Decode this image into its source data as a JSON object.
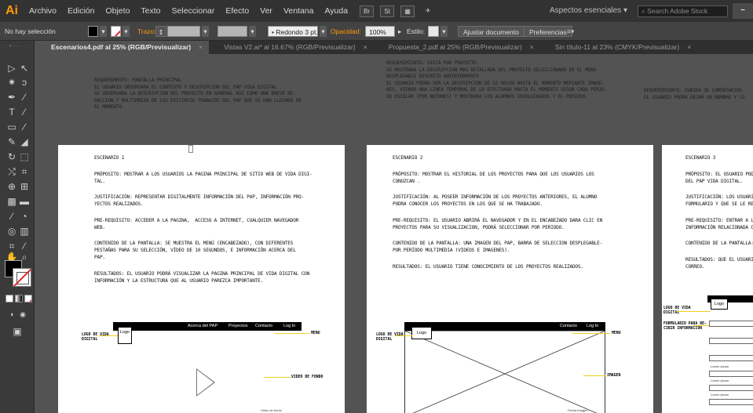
{
  "app": {
    "logo": "Ai",
    "menus": [
      "Archivo",
      "Edición",
      "Objeto",
      "Texto",
      "Seleccionar",
      "Efecto",
      "Ver",
      "Ventana",
      "Ayuda"
    ],
    "bridge_label": "Br",
    "stock_label": "St",
    "workspace": "Aspectos esenciales",
    "stock_search_placeholder": "Search Adobe Stock",
    "minimize": "–"
  },
  "control_bar": {
    "selection": "No hay selección",
    "stroke_label": "Trazo:",
    "brush": "• Redondo 3 pt.",
    "opacity_label": "Opacidad:",
    "opacity_value": "100%",
    "style_label": "Estilo:",
    "fit_button": "Ajustar documento",
    "prefs_button": "Preferencias",
    "colors": {
      "fill": "#000000",
      "stroke": "#ffffff",
      "accent": "#ff9a00"
    }
  },
  "tabs": [
    {
      "label": "Escenarios4.pdf al 25% (RGB/Previsualizar)",
      "active": true
    },
    {
      "label": "Vistas V2.ai* al 16.67% (RGB/Previsualizar)",
      "active": false
    },
    {
      "label": "Propuesta_2.pdf al 25% (RGB/Previsualizar)",
      "active": false
    },
    {
      "label": "Sin título-11 al 23% (CMYK/Previsualizar)",
      "active": false
    }
  ],
  "tab_close": "×",
  "requirements": [
    "REQUERIMENTO: PANTALLA PRINCIPAL\nEL USUARIO OBSERVARA EL CONTEXTO Y DESCRIPCION DEL PAP VIDA DIGITAL .\nSE OBSERVARA LA DESCRIPCION DEL PROYECTO EN GENERAL ASI COMO UNA BREVE RE-\nDACCION Y MULTIMEDIA DE LOS DISTINTOS TRABAJOS DEL PAP QUE SE HAN LLEVADO EN\nEL MOMENTO.",
    "REQUERIMIENTO: VISTA POR PROYECTO\nSE MOSTRARA LA DESCRIPCION MAS DETALLADA DEL PROYECTO SELECCIONADO EN EL MENU\nDESPLEGABLE DESCRITO ANTERIORMENTE.\nEL USUARIO PODRA VER LA DESCRIPCION DE LO HECHO HASTA EL MOMENTO MEDIANTE IMAGE-\nNES, VIENDO UNA LINEA TEMPORAL DE LO EFECTUADO HASTA EL MOMENTO SEGUN CADA PERIO-\nDO ESCOLAR (POR BOTONES) Y MOSTRARA LOS ALUMNOS INVOLUCRADOS Y EL PERIODO.",
    "REQUERIMIENTO: SUBIDA DE COMENTARIOS\nEL USUARIO PODRA DEJAR UN NOMBRE Y CO"
  ],
  "artboards": [
    {
      "title": "ESCENARIO 1",
      "paragraphs": [
        "PRÓPOSITO: MOSTRAR A LOS USUARIOS LA PAGINA PRINCIPAL DE SITIO WEB DE VIDA DIGI-\nTAL.",
        "JUSTIFICACIÓN: REPRESENTAR DIGITALMENTE INFORMACIÓN DEL PAP, INFORMACIÓN PRO-\nYECTOS REALIZADOS.",
        "PRE-REQUISITO: ACCEDER A LA PAGINA,  ACCESO A INTERNET, CUALQUIER NAVEGADOR\nWEB.",
        "CONTENIDO DE LA PANTALLA: SE MUESTRA EL MENÚ (ENCABEZADO), CON DIFERENTES\nPESTAÑAS PARA SU SELECCIÓN, VÍDEO DE 10 SEGUNDOS, E INFORMACIÓN ACERCA DEL\nPAP.",
        "RESULTADOS: EL USUARIO PODRÁ VISUALIZAR LA PAGINA PRINCIPAL DE VIDA DIGITAL CON\nINFORMACIÓN Y LA ESTRUCTURA QUE AL USUARIO PAREZCA IMPORTANTE."
      ],
      "nav": [
        "Acerca del PAP",
        "Proyectos",
        "Contacto",
        "Log In"
      ],
      "logo": "Logo",
      "annotations": [
        "LOGO DE VIDA\nDIGITAL",
        "MENU",
        "VIDEO DE FONDO"
      ],
      "caption": "Video de fondo"
    },
    {
      "title": "ESCENARIO 2",
      "paragraphs": [
        "PRÓPOSITO: MOSTRAR EL HISTORIAL DE LOS PROYECTOS PARA QUE LOS USUARIOS LOS\nCONOZCAN .",
        "JUSTIFICACIÓN: AL POSEER INFORMACIÓN DE LOS PROYECTOS ANTERIORES, EL ALUMNO\nPODRA CONOCER LOS PROYECTOS EN LOS QUE SE HA TRABAJADO.",
        "PRE-REQUISITO: EL USUARIO ABRIRÁ EL NAVEGADOR Y EN EL ENCABEZADO DARA CLIC EN\nPROYECTOS PARA SU VISUALIZACION, PODRÁ SELECCIONAR POR PERIODO.",
        "CONTENIDO DE LA PANTALLA: UNA IMAGEN DEL PAP, BARRA DE SELECCION DESPLEGABLE-\nPOR PERÍODO MULTIMEDIA (VIDEOS E IMAGENES).",
        "RESULTADOS: EL USUARIO TIENE CONOCIMIENTO DE LOS PROYECTOS REALIZADOS."
      ],
      "nav": [
        "Contacto",
        "Log In"
      ],
      "logo": "Logo",
      "annotations": [
        "LOGO DE VIDA\nDIGITAL",
        "MENU",
        "IMAGEN"
      ],
      "caption": "Fecha Imagen"
    },
    {
      "title": "ESCENARIO 3",
      "paragraphs": [
        "PRÓPOSITO: EL USUARIO PODRÁ\nDEL PAP VIDA DIGITAL.",
        "JUSTIFICACIÓN: LOS USUARIOS\nFORMULARIO Y QUE SE LE RESP",
        "PRE-REQUISITO: ENTRAR A LA P\nINFORMACIÓN RELACIONADA C",
        "CONTENIDO DE LA PANTALLA: F",
        "RESULTADOS: QUE EL USUARIO\nCORREO."
      ],
      "logo": "Logo",
      "annotations": [
        "LOGO DE VIDA\nDIGITAL",
        "FORMULARIO PARA RE-\nCIBIR INFORMACION"
      ],
      "field_labels": [
        "Lorem Ipsum",
        "Lorem Ipsum",
        "Lorem Ipsum"
      ]
    }
  ]
}
